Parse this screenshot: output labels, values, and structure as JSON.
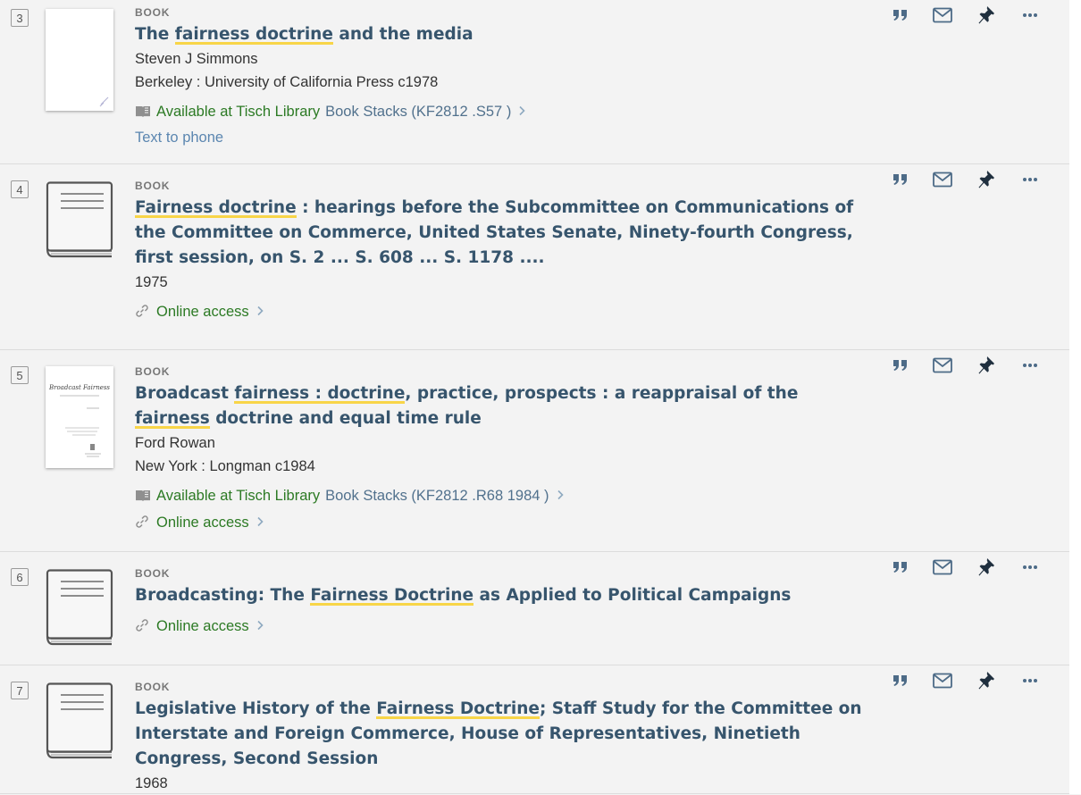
{
  "results": [
    {
      "num": "3",
      "type": "BOOK",
      "title_parts": [
        {
          "text": "The ",
          "hl": false
        },
        {
          "text": "fairness doctrine",
          "hl": true
        },
        {
          "text": " and the media",
          "hl": false
        }
      ],
      "meta": [
        "Steven J Simmons",
        "Berkeley : University of California Press c1978"
      ],
      "availability": [
        {
          "icon": "book-icon",
          "status": "Available at Tisch Library",
          "location": "Book Stacks (KF2812 .S57 )"
        }
      ],
      "extra_link": "Text to phone",
      "thumb": "cover-blank"
    },
    {
      "num": "4",
      "type": "BOOK",
      "title_parts": [
        {
          "text": "Fairness doctrine",
          "hl": true
        },
        {
          "text": " : hearings before the Subcommittee on Communications of the Committee on Commerce, United States Senate, Ninety-fourth Congress, first session, on S. 2 ... S. 608 ... S. 1178 ....",
          "hl": false
        }
      ],
      "meta": [
        "1975"
      ],
      "availability": [
        {
          "icon": "link-icon",
          "status": "Online access",
          "location": ""
        }
      ],
      "thumb": "book-placeholder"
    },
    {
      "num": "5",
      "type": "BOOK",
      "title_parts": [
        {
          "text": "Broadcast ",
          "hl": false
        },
        {
          "text": "fairness : doctrine",
          "hl": true
        },
        {
          "text": ", practice, prospects : a reappraisal of the ",
          "hl": false
        },
        {
          "text": "fairness",
          "hl": true
        },
        {
          "text": " doctrine and equal time rule",
          "hl": false
        }
      ],
      "meta": [
        "Ford Rowan",
        "New York : Longman c1984"
      ],
      "availability": [
        {
          "icon": "book-icon",
          "status": "Available at Tisch Library",
          "location": "Book Stacks (KF2812 .R68 1984 )"
        },
        {
          "icon": "link-icon",
          "status": "Online access",
          "location": ""
        }
      ],
      "thumb": "cover-printed",
      "cover_title": "Broadcast Fairness"
    },
    {
      "num": "6",
      "type": "BOOK",
      "title_parts": [
        {
          "text": "Broadcasting: The ",
          "hl": false
        },
        {
          "text": "Fairness Doctrine",
          "hl": true
        },
        {
          "text": " as Applied to Political Campaigns",
          "hl": false
        }
      ],
      "meta": [],
      "availability": [
        {
          "icon": "link-icon",
          "status": "Online access",
          "location": ""
        }
      ],
      "thumb": "book-placeholder"
    },
    {
      "num": "7",
      "type": "BOOK",
      "title_parts": [
        {
          "text": "Legislative History of the ",
          "hl": false
        },
        {
          "text": "Fairness Doctrine",
          "hl": true
        },
        {
          "text": "; Staff Study for the Committee on Interstate and Foreign Commerce, House of Representatives, Ninetieth Congress, Second Session",
          "hl": false
        }
      ],
      "meta": [
        "1968"
      ],
      "availability": [],
      "thumb": "book-placeholder"
    }
  ],
  "actions": [
    {
      "name": "cite-icon",
      "label": "Cite"
    },
    {
      "name": "email-icon",
      "label": "Email"
    },
    {
      "name": "pin-icon",
      "label": "Pin"
    },
    {
      "name": "more-icon",
      "label": "More"
    }
  ],
  "colors": {
    "title": "#37556d",
    "available": "#2c7a24",
    "location": "#51718d",
    "highlight": "#f8d548",
    "action_icons": "#4d6b87",
    "pin": "#1f2f3e"
  }
}
